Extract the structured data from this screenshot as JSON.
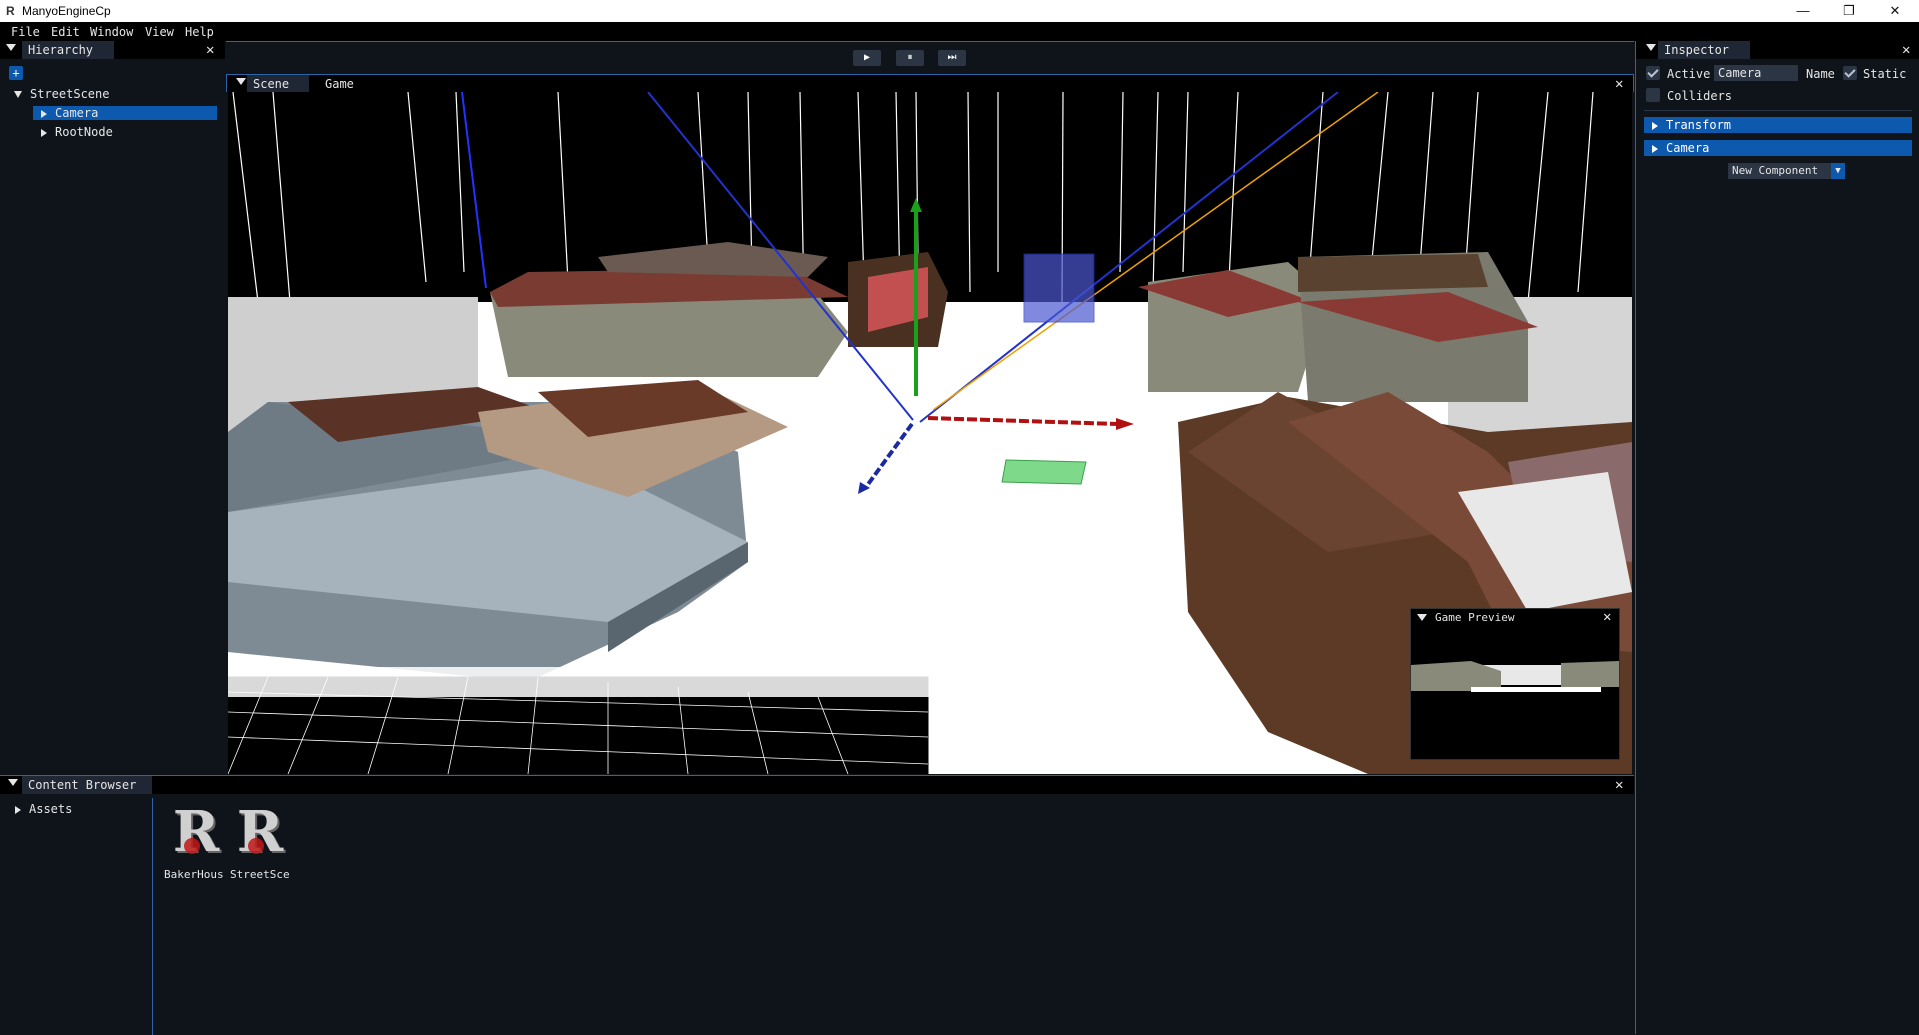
{
  "window": {
    "title": "ManyoEngineCp"
  },
  "menu": [
    "File",
    "Edit",
    "Window",
    "View",
    "Help"
  ],
  "hierarchy": {
    "tab": "Hierarchy",
    "add_label": "+",
    "root": "StreetScene",
    "children": [
      "Camera",
      "RootNode"
    ],
    "selected": "Camera"
  },
  "toolbar": {
    "play": "▶",
    "pause": "⏸",
    "step": "⏭"
  },
  "scene_tabs": [
    "Scene",
    "Game"
  ],
  "game_preview": {
    "title": "Game Preview"
  },
  "inspector": {
    "tab": "Inspector",
    "active_label": "Active",
    "active_checked": true,
    "name_value": "Camera",
    "name_label": "Name",
    "static_label": "Static",
    "static_checked": true,
    "colliders_label": "Colliders",
    "colliders_checked": false,
    "components": [
      "Transform",
      "Camera"
    ],
    "new_component_label": "New Component"
  },
  "content_browser": {
    "tab": "Content Browser",
    "folder": "Assets",
    "files": [
      "BakerHous",
      "StreetSce"
    ]
  },
  "colors": {
    "accent": "#0d59ad",
    "panel_bg": "#0f131a",
    "field_bg": "#2b3544"
  }
}
